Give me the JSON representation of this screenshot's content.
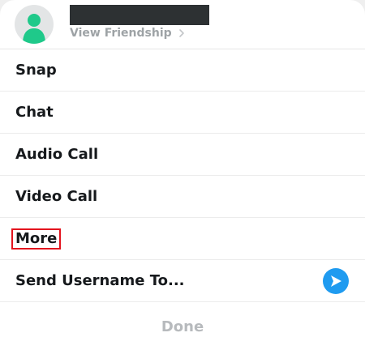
{
  "header": {
    "view_friendship_label": "View Friendship"
  },
  "menu": {
    "items": [
      {
        "label": "Snap"
      },
      {
        "label": "Chat"
      },
      {
        "label": "Audio Call"
      },
      {
        "label": "Video Call"
      },
      {
        "label": "More"
      },
      {
        "label": "Send Username To..."
      }
    ]
  },
  "footer": {
    "done_label": "Done"
  },
  "colors": {
    "avatar_green": "#1fc98a",
    "send_blue": "#1f9bf0",
    "highlight_red": "#e3141e"
  },
  "icons": {
    "avatar": "person-silhouette-icon",
    "chevron": "chevron-right-icon",
    "send": "send-arrow-icon"
  }
}
